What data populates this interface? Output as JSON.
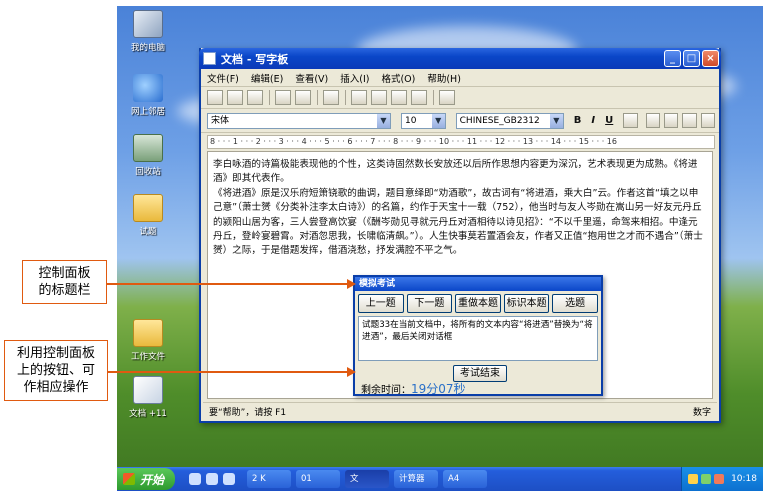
{
  "desktop": {
    "icons": [
      {
        "label": "我的电脑",
        "kind": "pc"
      },
      {
        "label": "网上邻居",
        "kind": "net"
      },
      {
        "label": "回收站",
        "kind": "bin"
      },
      {
        "label": "试题",
        "kind": "folder"
      },
      {
        "label": "工作文件",
        "kind": "folder"
      },
      {
        "label": "文档 +11",
        "kind": "doc"
      }
    ]
  },
  "wordpad": {
    "title": "文档 - 写字板",
    "window_controls": {
      "minimize": "_",
      "maximize": "□",
      "close": "×"
    },
    "menu": [
      "文件(F)",
      "编辑(E)",
      "查看(V)",
      "插入(I)",
      "格式(O)",
      "帮助(H)"
    ],
    "font_name": "宋体",
    "font_size": "10",
    "script": "CHINESE_GB2312",
    "format_buttons": {
      "bold": "B",
      "italic": "I",
      "underline": "U"
    },
    "ruler": "8 · · · 1 · · · 2 · · · 3 · · · 4 · · · 5 · · · 6 · · · 7 · · · 8 · · · 9 · · · 10 · · · 11 · · · 12 · · · 13 · · · 14 · · · 15 · · · 16",
    "document": {
      "para1": "李白咏酒的诗篇极能表现他的个性，这类诗固然数长安放还以后所作思想内容更为深沉，艺术表现更为成熟。《将进酒》即其代表作。",
      "para2": "《将进酒》原是汉乐府短箫铙歌的曲调，题目意绎即“劝酒歌”，故古词有“将进酒，乘大白”云。作者这首“填之以申己意”（萧士赟《分类补注李太白诗》）的名篇，约作于天宝十一载（752），他当时与友人岑勋在嵩山另一好友元丹丘的颍阳山居为客，三人尝登高饮宴（《酬岑勋见寻就元丹丘对酒相待以诗见招》：“不以千里遥，命驾来相招。中逢元丹丘，登岭宴碧霄。对酒忽思我，长啸临清飙。”）。人生快事莫若置酒会友，作者又正值“抱用世之才而不遇合”（萧士赟）之际，于是借题发挥，借酒浇愁，抒发满腔不平之气。"
    },
    "status": {
      "left": "要“帮助”，请按 F1",
      "right": "数字"
    }
  },
  "panel": {
    "title": "模拟考试",
    "buttons": [
      "上一题",
      "下一题",
      "重做本题",
      "标识本题",
      "选题"
    ],
    "question": "试题33在当前文档中，将所有的文本内容“将进酒”替换为“将进酒”，最后关闭对话框",
    "end_button": "考试结束",
    "time_label": "剩余时间：",
    "time_value": "19分07秒"
  },
  "taskbar": {
    "start": "开始",
    "tasks": [
      "2 K",
      "01",
      "文",
      "计算器",
      "A4"
    ],
    "clock": "10:18"
  },
  "callouts": {
    "title_bar": [
      "控制面板",
      "的标题栏"
    ],
    "buttons": [
      "利用控制面板",
      "上的按钮、可",
      "作相应操作"
    ]
  }
}
